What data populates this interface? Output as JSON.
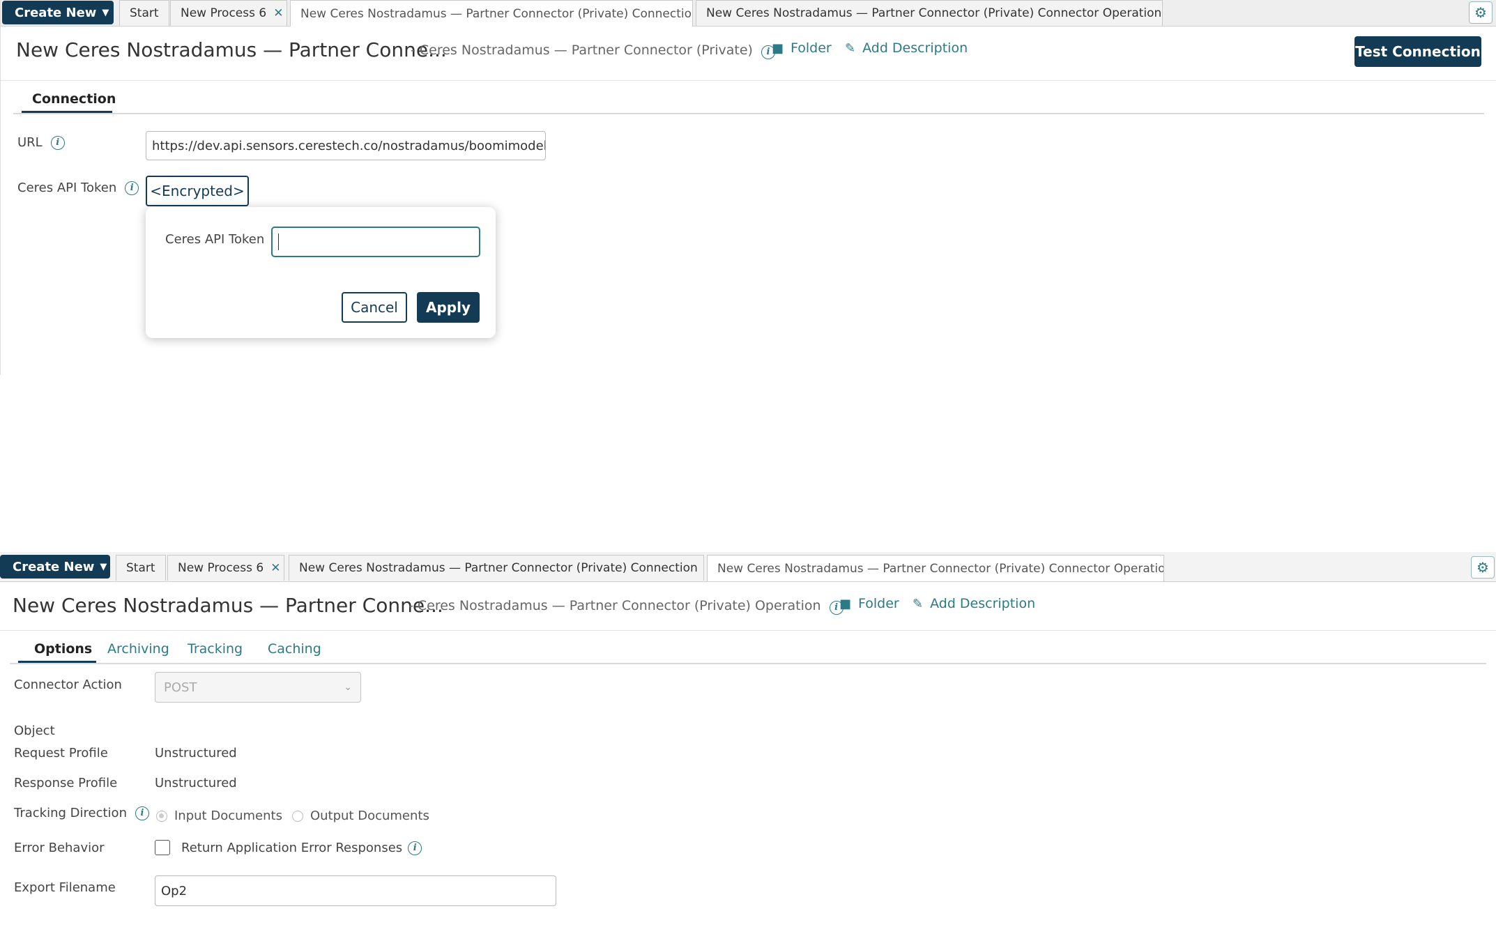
{
  "panel1": {
    "tabbar": {
      "create_new": "Create New",
      "tabs": [
        {
          "label": "Start"
        },
        {
          "label": "New Process 6"
        },
        {
          "label": "New Ceres Nostradamus — Partner Connector (Private) Connection"
        },
        {
          "label": "New Ceres Nostradamus — Partner Connector (Private) Connector Operation"
        }
      ]
    },
    "header": {
      "title": "New Ceres Nostradamus — Partner Conne...",
      "subtitle": "- Ceres Nostradamus — Partner Connector (Private)",
      "folder": "Folder",
      "add_description": "Add Description",
      "test_connection": "Test Connection"
    },
    "subtabs": [
      "Connection"
    ],
    "form": {
      "url_label": "URL",
      "url_value": "https://dev.api.sensors.cerestech.co/nostradamus/boomimodeltra",
      "token_label": "Ceres API Token",
      "token_value": "<Encrypted>"
    },
    "popup": {
      "label": "Ceres API Token",
      "value": "",
      "cancel": "Cancel",
      "apply": "Apply"
    }
  },
  "panel2": {
    "tabbar": {
      "create_new": "Create New",
      "tabs": [
        {
          "label": "Start"
        },
        {
          "label": "New Process 6"
        },
        {
          "label": "New Ceres Nostradamus — Partner Connector (Private) Connection"
        },
        {
          "label": "New Ceres Nostradamus — Partner Connector (Private) Connector Operation"
        }
      ]
    },
    "header": {
      "title": "New Ceres Nostradamus — Partner Conne...",
      "subtitle": "- Ceres Nostradamus — Partner Connector (Private) Operation",
      "folder": "Folder",
      "add_description": "Add Description"
    },
    "subtabs": [
      "Options",
      "Archiving",
      "Tracking",
      "Caching"
    ],
    "form": {
      "connector_action_label": "Connector Action",
      "connector_action_value": "POST",
      "object_label": "Object",
      "request_profile_label": "Request Profile",
      "request_profile_value": "Unstructured",
      "response_profile_label": "Response Profile",
      "response_profile_value": "Unstructured",
      "tracking_direction_label": "Tracking Direction",
      "tracking_input": "Input Documents",
      "tracking_output": "Output Documents",
      "error_behavior_label": "Error Behavior",
      "error_behavior_checkbox": "Return Application Error Responses",
      "export_filename_label": "Export Filename",
      "export_filename_value": "Op2"
    }
  },
  "colors": {
    "primary": "#143b55",
    "accent": "#2b7a86",
    "tabbar_bg": "#eeeeee"
  },
  "icons": {
    "info": "info-icon",
    "folder": "folder-icon",
    "pencil": "pencil-icon",
    "gear": "gear-icon",
    "close": "close-icon",
    "caret": "caret-down-icon",
    "chevron": "chevron-down-icon"
  }
}
